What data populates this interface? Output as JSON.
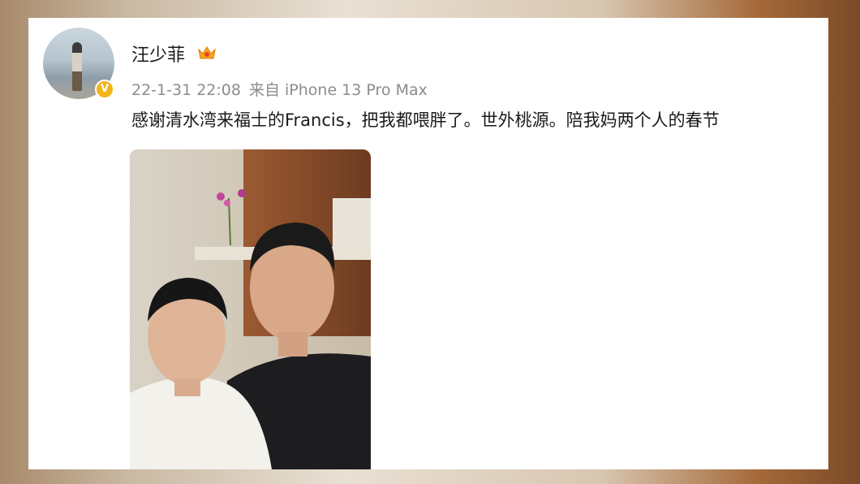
{
  "post": {
    "username": "汪少菲",
    "timestamp": "22-1-31 22:08",
    "source": "来自 iPhone 13 Pro Max",
    "text": "感谢清水湾来福士的Francis，把我都喂胖了。世外桃源。陪我妈两个人的春节",
    "verified_mark": "V"
  },
  "icons": {
    "avatar": "user-avatar",
    "badge": "verified-badge-icon",
    "crown": "member-crown-icon"
  },
  "colors": {
    "badge": "#f3b419",
    "meta_text": "#8c8c8c",
    "body_text": "#1a1a1a"
  }
}
